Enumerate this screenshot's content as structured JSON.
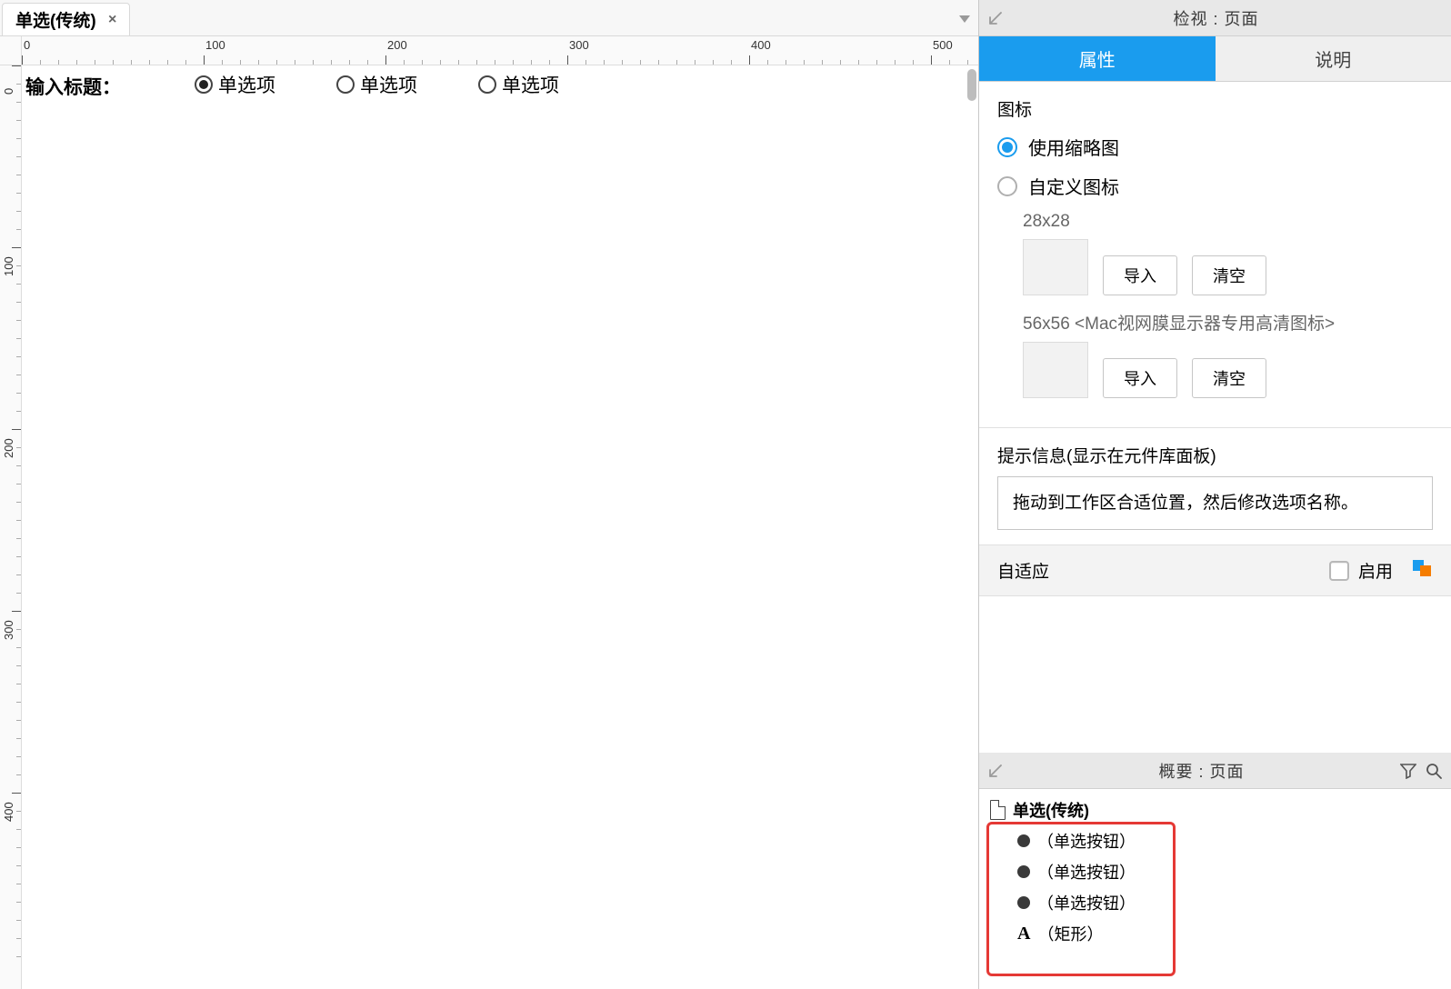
{
  "tab": {
    "title": "单选(传统)",
    "close": "×"
  },
  "ruler": {
    "ticks": [
      0,
      100,
      200,
      300,
      400,
      500
    ]
  },
  "canvas": {
    "title": "输入标题：",
    "options": [
      {
        "label": "单选项",
        "checked": true
      },
      {
        "label": "单选项",
        "checked": false
      },
      {
        "label": "单选项",
        "checked": false
      }
    ]
  },
  "inspector": {
    "title": "检视 : 页面",
    "tabs": {
      "props": "属性",
      "notes": "说明"
    },
    "icon_section": {
      "heading": "图标",
      "use_thumbnail": "使用缩略图",
      "custom_icon": "自定义图标",
      "size_28": "28x28",
      "size_56": "56x56 <Mac视网膜显示器专用高清图标>",
      "import": "导入",
      "clear": "清空"
    },
    "hint": {
      "label": "提示信息(显示在元件库面板)",
      "body": "拖动到工作区合适位置，然后修改选项名称。"
    },
    "adaptive": {
      "label": "自适应",
      "enable": "启用"
    }
  },
  "outline": {
    "title": "概要 : 页面",
    "page": "单选(传统)",
    "items": [
      {
        "type": "radio",
        "label": "（单选按钮）"
      },
      {
        "type": "radio",
        "label": "（单选按钮）"
      },
      {
        "type": "radio",
        "label": "（单选按钮）"
      },
      {
        "type": "text",
        "label": "（矩形）"
      }
    ]
  }
}
